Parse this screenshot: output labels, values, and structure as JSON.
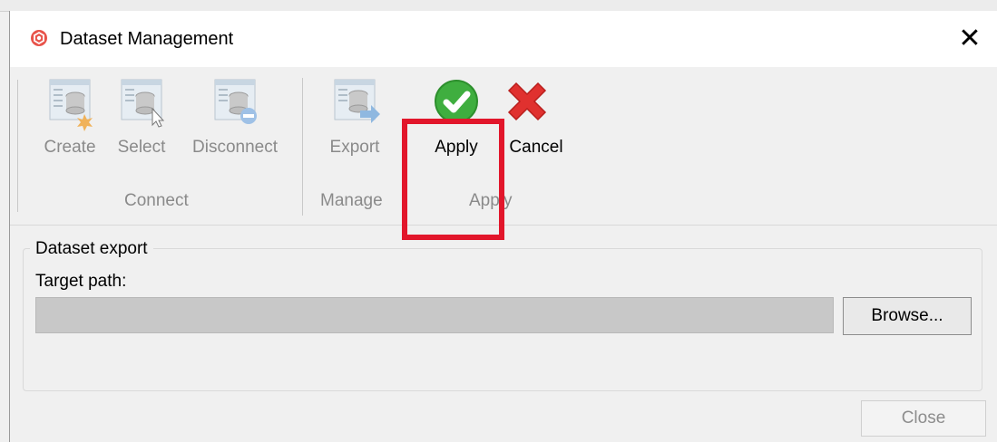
{
  "window": {
    "title": "Dataset Management",
    "close_glyph": "✕"
  },
  "ribbon": {
    "groups": [
      {
        "label": "Connect",
        "buttons": [
          {
            "label": "Create",
            "icon": "dataset-create-icon",
            "enabled": false
          },
          {
            "label": "Select",
            "icon": "dataset-select-icon",
            "enabled": false
          },
          {
            "label": "Disconnect",
            "icon": "dataset-disconnect-icon",
            "enabled": false
          }
        ]
      },
      {
        "label": "Manage",
        "buttons": [
          {
            "label": "Export",
            "icon": "dataset-export-icon",
            "enabled": false
          }
        ]
      },
      {
        "label": "Apply",
        "buttons": [
          {
            "label": "Apply",
            "icon": "green-check-icon",
            "enabled": true
          },
          {
            "label": "Cancel",
            "icon": "red-x-icon",
            "enabled": true
          }
        ]
      }
    ]
  },
  "export_panel": {
    "title": "Dataset export",
    "target_label": "Target path:",
    "target_value": "",
    "browse_label": "Browse..."
  },
  "footer": {
    "close_label": "Close"
  },
  "colors": {
    "highlight": "#e2162b",
    "apply_green": "#3fae3f",
    "cancel_red": "#e0312f"
  }
}
